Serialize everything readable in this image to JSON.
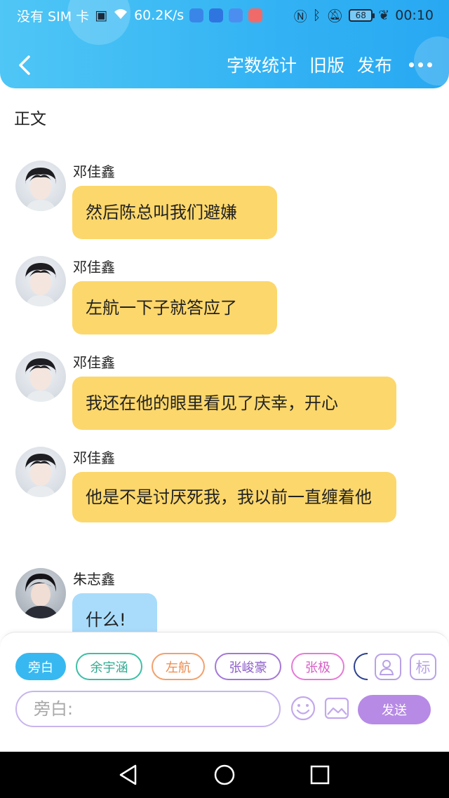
{
  "status_bar": {
    "carrier": "没有 SIM 卡",
    "network_speed": "60.2K/s",
    "battery": "68",
    "time": "00:10"
  },
  "nav": {
    "word_count": "字数统计",
    "old_version": "旧版",
    "publish": "发布"
  },
  "section_title": "正文",
  "messages": [
    {
      "sender": "邓佳鑫",
      "text": "然后陈总叫我们避嫌"
    },
    {
      "sender": "邓佳鑫",
      "text": "左航一下子就答应了"
    },
    {
      "sender": "邓佳鑫",
      "text": "我还在他的眼里看见了庆幸，开心"
    },
    {
      "sender": "邓佳鑫",
      "text": "他是不是讨厌死我，我以前一直缠着他"
    },
    {
      "sender": "朱志鑫",
      "text": "什么!"
    }
  ],
  "role_chips": [
    {
      "label": "旁白",
      "color": "#38b8f0",
      "selected": true
    },
    {
      "label": "余宇涵",
      "color": "#3cbfa4",
      "selected": false
    },
    {
      "label": "左航",
      "color": "#f3a06b",
      "selected": false
    },
    {
      "label": "张峻豪",
      "color": "#a477d8",
      "selected": false
    },
    {
      "label": "张极",
      "color": "#e67ad8",
      "selected": false
    }
  ],
  "side_buttons": {
    "tag_label": "标"
  },
  "composer": {
    "placeholder": "旁白:",
    "send_label": "发送"
  },
  "colors": {
    "header": "#33b3f4",
    "bubble": "#fcd76b",
    "accent": "#b78ae6"
  }
}
